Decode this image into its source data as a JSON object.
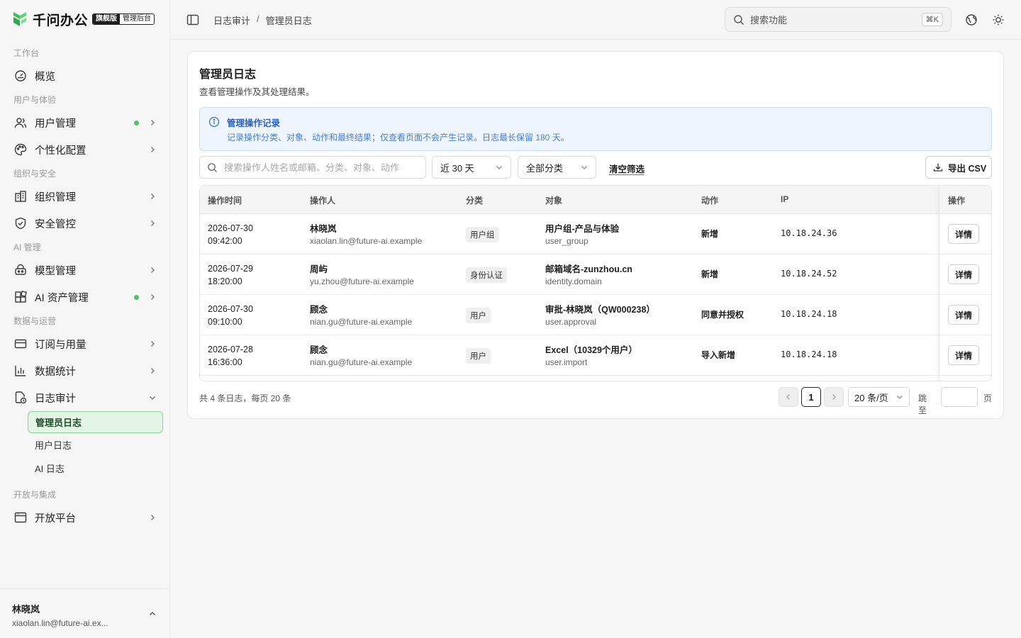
{
  "brand": {
    "name": "千问办公",
    "edition": "旗舰版",
    "admin": "管理后台",
    "accent": "#3fbf5a"
  },
  "sidebar": {
    "sections": [
      {
        "title": "工作台"
      },
      {
        "title": "用户与体验"
      },
      {
        "title": "组织与安全"
      },
      {
        "title": "AI 管理"
      },
      {
        "title": "数据与运营"
      },
      {
        "title": "开放与集成"
      }
    ],
    "items": {
      "overview": "概览",
      "users": "用户管理",
      "personalize": "个性化配置",
      "org": "组织管理",
      "security": "安全管控",
      "models": "模型管理",
      "assets": "AI 资产管理",
      "subscription": "订阅与用量",
      "stats": "数据统计",
      "audit": "日志审计",
      "open": "开放平台"
    },
    "audit_sub": {
      "admin_log": "管理员日志",
      "user_log": "用户日志",
      "ai_log": "AI 日志"
    },
    "user": {
      "name": "林晓岚",
      "email": "xiaolan.lin@future-ai.ex..."
    }
  },
  "topbar": {
    "breadcrumb": [
      "日志审计",
      "/",
      "管理员日志"
    ],
    "search_placeholder": "搜索功能",
    "search_shortcut": "⌘K"
  },
  "page": {
    "title": "管理员日志",
    "subtitle": "查看管理操作及其处理结果。",
    "notice_title": "管理操作记录",
    "notice_text": "记录操作分类、对象、动作和最终结果；仅查看页面不会产生记录。日志最长保留 180 天。"
  },
  "filters": {
    "search_placeholder": "搜索操作人姓名或邮箱、分类、对象、动作",
    "range": "近 30 天",
    "category": "全部分类",
    "clear": "清空筛选",
    "export": "导出 CSV"
  },
  "table": {
    "headers": {
      "time": "操作时间",
      "operator": "操作人",
      "category": "分类",
      "object": "对象",
      "action": "动作",
      "ip": "IP",
      "op": "操作"
    },
    "detail_label": "详情",
    "rows": [
      {
        "date": "2026-07-30",
        "time": "09:42:00",
        "name": "林晓岚",
        "email": "xiaolan.lin@future-ai.example",
        "category": "用户组",
        "object": "用户组-产品与体验",
        "code": "user_group",
        "action": "新增",
        "ip": "10.18.24.36"
      },
      {
        "date": "2026-07-29",
        "time": "18:20:00",
        "name": "周屿",
        "email": "yu.zhou@future-ai.example",
        "category": "身份认证",
        "object": "邮箱域名-zunzhou.cn",
        "code": "identity.domain",
        "action": "新增",
        "ip": "10.18.24.52"
      },
      {
        "date": "2026-07-30",
        "time": "09:10:00",
        "name": "顾念",
        "email": "nian.gu@future-ai.example",
        "category": "用户",
        "object": "审批-林晓岚（QW000238）",
        "code": "user.approval",
        "action": "同意并授权",
        "ip": "10.18.24.18"
      },
      {
        "date": "2026-07-28",
        "time": "16:36:00",
        "name": "顾念",
        "email": "nian.gu@future-ai.example",
        "category": "用户",
        "object": "Excel（10329个用户）",
        "code": "user.import",
        "action": "导入新增",
        "ip": "10.18.24.18"
      }
    ]
  },
  "pagination": {
    "summary": "共 4 条日志，每页 20 条",
    "current": "1",
    "page_size": "20 条/页",
    "jump_label": "跳至",
    "page_label": "页"
  }
}
